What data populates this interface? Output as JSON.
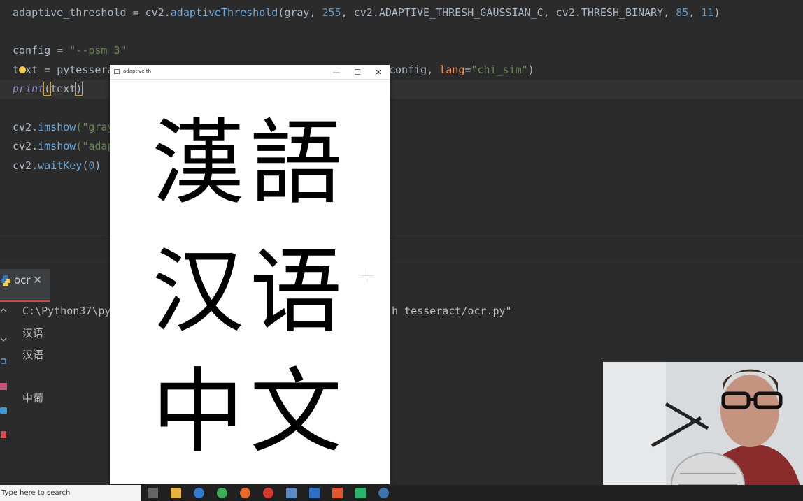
{
  "editor": {
    "line1": {
      "var": "adaptive_threshold",
      "eq": " = cv2.",
      "fn": "adaptiveThreshold",
      "open": "(gray, ",
      "n1": "255",
      "mid": ", cv2.ADAPTIVE_THRESH_GAUSSIAN_C, cv2.THRESH_BINARY, ",
      "n2": "85",
      "sep": ", ",
      "n3": "11",
      "close": ")"
    },
    "line3": {
      "pre": "config = ",
      "str": "\"--psm 3\""
    },
    "line4": {
      "pre": "text = pytessera",
      "post_a": "config, ",
      "kw": "lang",
      "eq": "=",
      "str": "\"chi_sim\"",
      "close": ")"
    },
    "line5": {
      "fn": "print",
      "open": "(",
      "arg": "text",
      "close": ")"
    },
    "line7": {
      "pre": "cv2.",
      "fn": "imshow",
      "post": "(\"gray"
    },
    "line8": {
      "pre": "cv2.",
      "fn": "imshow",
      "post": "(\"adap"
    },
    "line9": {
      "pre": "cv2.",
      "fn": "waitKey",
      "open": "(",
      "num": "0",
      "close": ")"
    }
  },
  "run_tab": {
    "label": "ocr",
    "close": "✕"
  },
  "console": {
    "command_start": "C:\\Python37\\pyt",
    "command_end": "h tesseract/ocr.py\"",
    "output": [
      "汉语",
      "汉语",
      "中葡"
    ]
  },
  "cv_window": {
    "title": "adaptive th",
    "minimize": "—",
    "maximize": "☐",
    "close": "✕",
    "rows": [
      "漢語",
      "汉语",
      "中文"
    ]
  },
  "taskbar": {
    "search_placeholder": "Type here to search"
  },
  "colors": {
    "editor_bg": "#2b2b2b",
    "taskbar_bg": "#202020",
    "tab_underline": "#c3504a"
  }
}
